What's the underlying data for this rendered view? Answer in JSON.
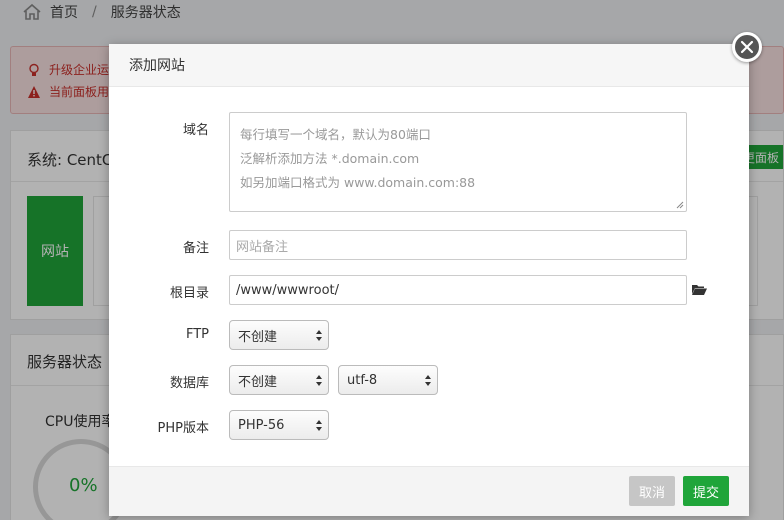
{
  "breadcrumb": {
    "home": "首页",
    "separator": "/",
    "current": "服务器状态"
  },
  "alerts": [
    {
      "icon": "lightbulb-icon",
      "text": "升级企业运"
    },
    {
      "icon": "warning-icon",
      "text": "当前面板用"
    }
  ],
  "system_panel": {
    "title": "系统: CentC",
    "tile_label": "网站",
    "right_button": "更面板"
  },
  "status_panel": {
    "title": "服务器状态",
    "cpu_label": "CPU使用率",
    "cpu_value": "0%"
  },
  "modal": {
    "title": "添加网站",
    "fields": {
      "domain": {
        "label": "域名",
        "placeholder_lines": [
          "每行填写一个域名，默认为80端口",
          "泛解析添加方法 *.domain.com",
          "如另加端口格式为 www.domain.com:88"
        ]
      },
      "remark": {
        "label": "备注",
        "placeholder": "网站备注"
      },
      "root": {
        "label": "根目录",
        "value": "/www/wwwroot/"
      },
      "ftp": {
        "label": "FTP",
        "selected": "不创建"
      },
      "database": {
        "label": "数据库",
        "selected": "不创建",
        "charset": "utf-8"
      },
      "php": {
        "label": "PHP版本",
        "selected": "PHP-56"
      }
    },
    "buttons": {
      "cancel": "取消",
      "submit": "提交"
    }
  },
  "colors": {
    "accent": "#20a53a",
    "alert_text": "#c9302c",
    "cancel_bg": "#c6c6c6"
  }
}
